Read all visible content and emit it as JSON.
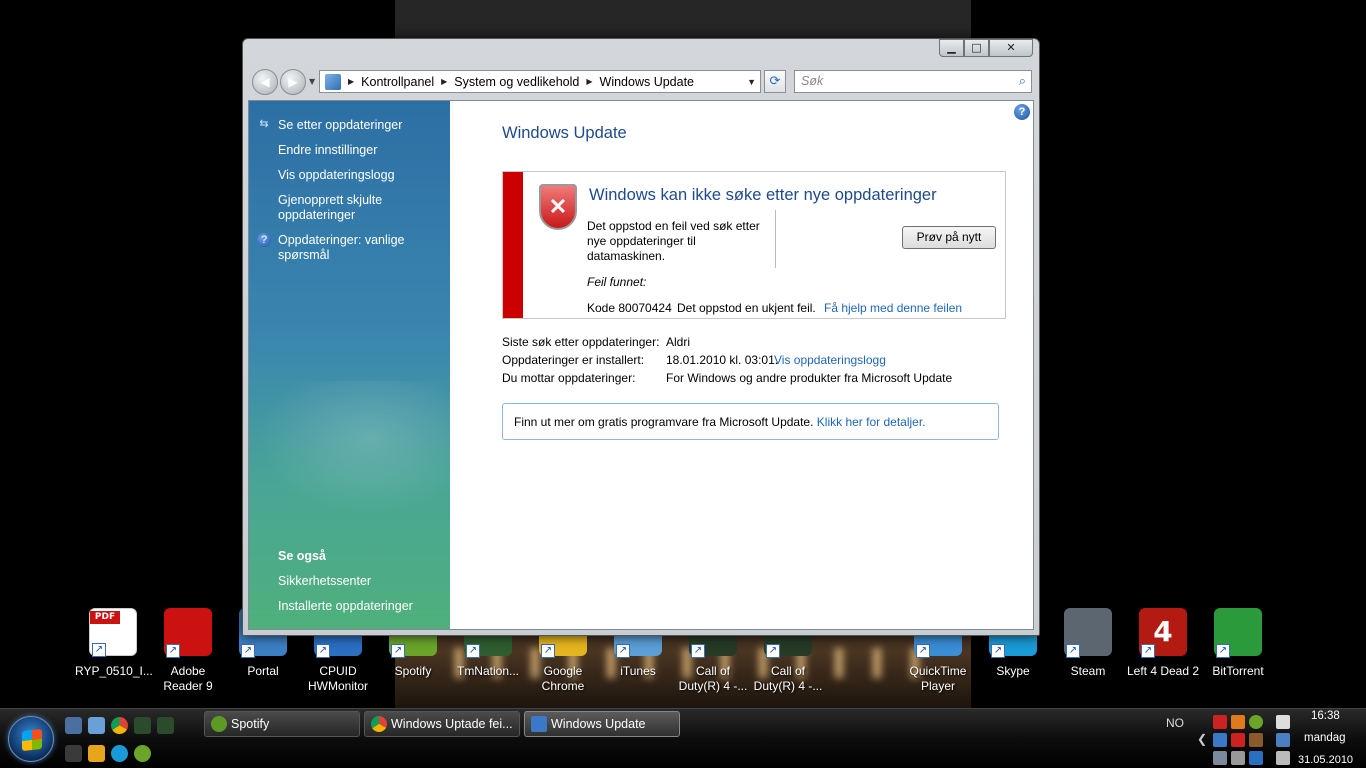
{
  "window": {
    "breadcrumb": [
      "Kontrollpanel",
      "System og vedlikehold",
      "Windows Update"
    ],
    "search_placeholder": "Søk"
  },
  "sidebar": {
    "tasks": [
      {
        "label": "Se etter oppdateringer",
        "icon": "windows-update-icon"
      },
      {
        "label": "Endre innstillinger"
      },
      {
        "label": "Vis oppdateringslogg"
      },
      {
        "label": "Gjenopprett skjulte oppdateringer"
      },
      {
        "label": "Oppdateringer: vanlige spørsmål",
        "icon": "help-icon"
      }
    ],
    "see_also_title": "Se også",
    "see_also": [
      "Sikkerhetssenter",
      "Installerte oppdateringer"
    ]
  },
  "main": {
    "title": "Windows Update",
    "error": {
      "title": "Windows kan ikke søke etter nye oppdateringer",
      "description": "Det oppstod en feil ved søk etter nye oppdateringer til datamaskinen.",
      "retry_label": "Prøv på nytt",
      "found_label": "Feil funnet:",
      "code": "Kode 80070424",
      "message": "Det oppstod en ukjent feil.",
      "help_link": "Få hjelp med denne feilen"
    },
    "info": [
      {
        "label": "Siste søk etter oppdateringer:",
        "value": "Aldri"
      },
      {
        "label": "Oppdateringer er installert:",
        "value": "18.01.2010 kl. 03:01.",
        "link": "Vis oppdateringslogg"
      },
      {
        "label": "Du mottar oppdateringer:",
        "value": "For Windows og andre produkter fra Microsoft Update"
      }
    ],
    "infobox_text": "Finn ut mer om gratis programvare fra Microsoft Update.",
    "infobox_link": "Klikk her for detaljer."
  },
  "desktop_icons": [
    {
      "label": "RYP_0510_I...",
      "icon": "pdf-file-icon",
      "color": "#ffffff"
    },
    {
      "label": "Adobe Reader 9",
      "icon": "adobe-reader-icon",
      "color": "#cc1111"
    },
    {
      "label": "Portal",
      "icon": "portal-icon",
      "color": "#3b7fc4"
    },
    {
      "label": "CPUID HWMonitor",
      "icon": "hwmonitor-icon",
      "color": "#2a6fc2"
    },
    {
      "label": "Spotify",
      "icon": "spotify-icon",
      "color": "#6aa52a"
    },
    {
      "label": "TmNation...",
      "icon": "tmnation-icon",
      "color": "#2f5d2f"
    },
    {
      "label": "Google Chrome",
      "icon": "chrome-icon",
      "color": "#e5b520"
    },
    {
      "label": "iTunes",
      "icon": "itunes-icon",
      "color": "#5a9fd8"
    },
    {
      "label": "Call of Duty(R) 4 -...",
      "icon": "cod4-icon",
      "color": "#263a26"
    },
    {
      "label": "Call of Duty(R) 4 -...",
      "icon": "cod4-mp-icon",
      "color": "#263a26"
    },
    {
      "label": "QuickTime Player",
      "icon": "quicktime-icon",
      "color": "#3a8ed6"
    },
    {
      "label": "Skype",
      "icon": "skype-icon",
      "color": "#1a9ad6"
    },
    {
      "label": "Steam",
      "icon": "steam-icon",
      "color": "#5c6670"
    },
    {
      "label": "Left 4 Dead 2",
      "icon": "l4d2-icon",
      "color": "#b31a12"
    },
    {
      "label": "BitTorrent",
      "icon": "bittorrent-icon",
      "color": "#2a9a3a"
    }
  ],
  "taskbar": {
    "buttons": [
      {
        "label": "Spotify",
        "icon": "spotify-icon",
        "color": "#5c9a24"
      },
      {
        "label": "Windows Uptade fei...",
        "icon": "chrome-icon",
        "color": "#e5b520"
      },
      {
        "label": "Windows Update",
        "icon": "windows-update-icon",
        "color": "#3a78c8"
      }
    ],
    "language": "NO",
    "time": "16:38",
    "day": "mandag",
    "date": "31.05.2010"
  }
}
